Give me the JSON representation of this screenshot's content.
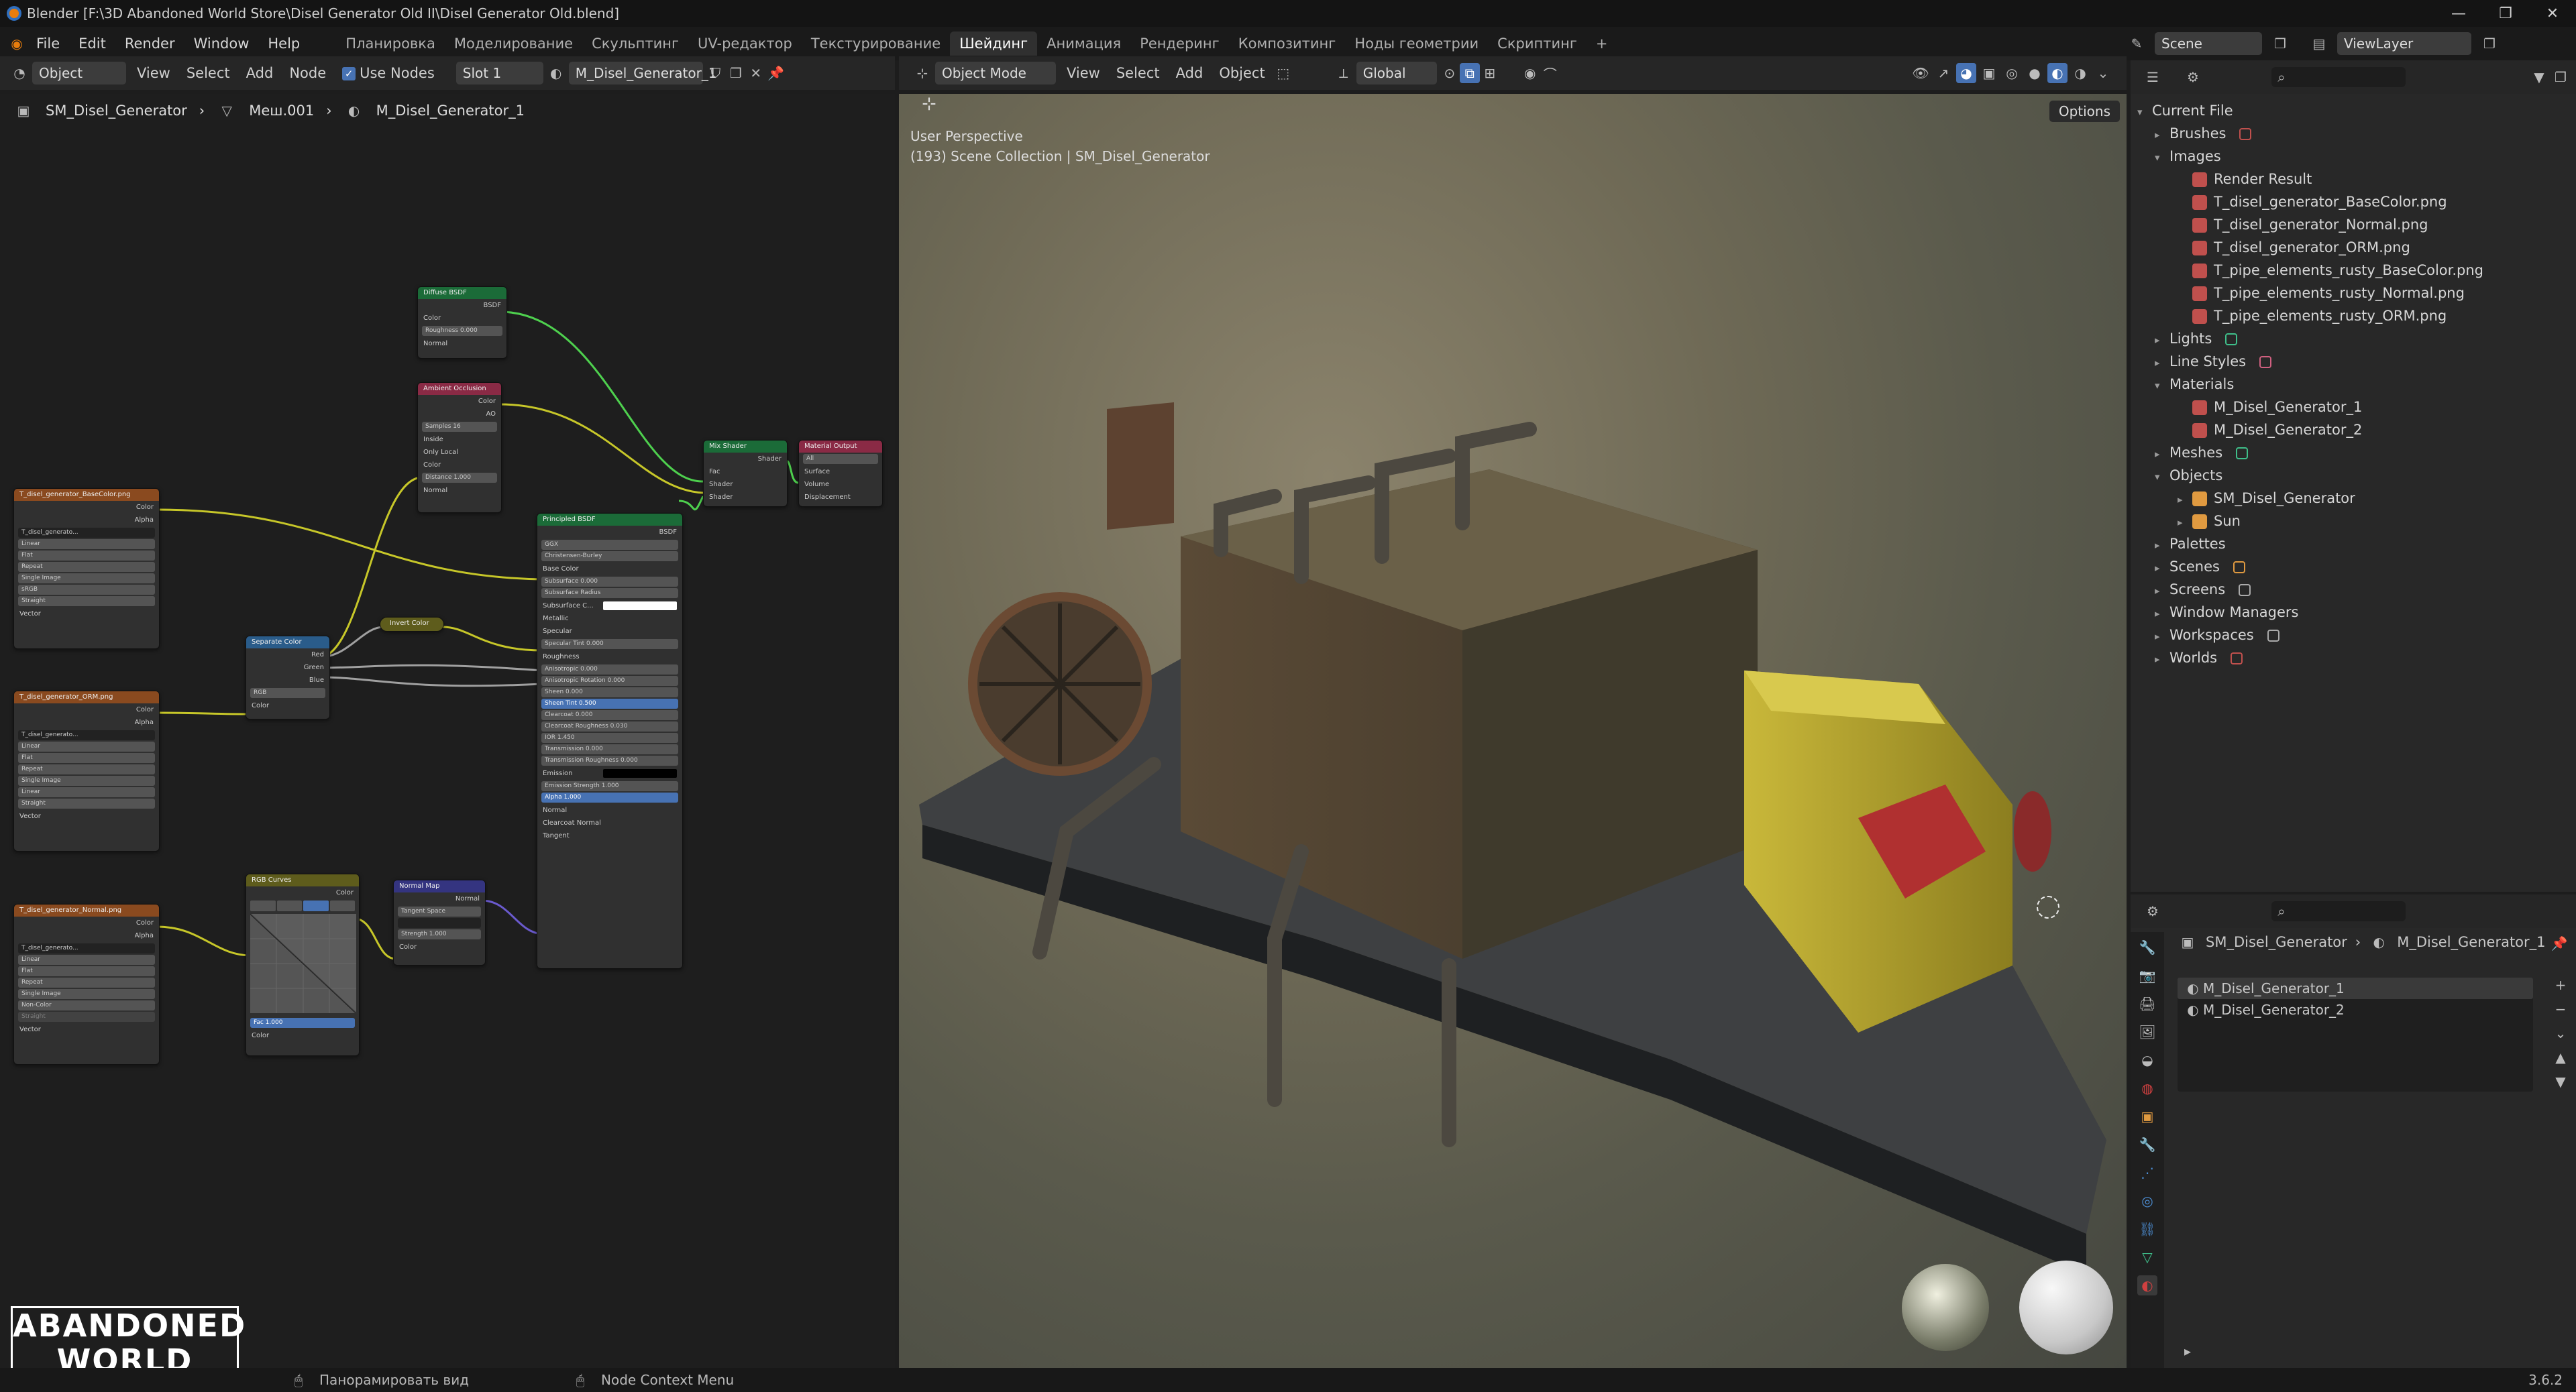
{
  "titlebar": {
    "title": "Blender [F:\\3D Abandoned World Store\\Disel Generator Old II\\Disel Generator Old.blend]",
    "controls": [
      "—",
      "❐",
      "✕"
    ]
  },
  "menu": {
    "items": [
      "File",
      "Edit",
      "Render",
      "Window",
      "Help"
    ],
    "workspaces": [
      "Планировка",
      "Моделирование",
      "Скульптинг",
      "UV-редактор",
      "Текстурирование",
      "Шейдинг",
      "Анимация",
      "Рендеринг",
      "Композитинг",
      "Ноды геометрии",
      "Скриптинг"
    ],
    "active_workspace": "Шейдинг",
    "add_tab": "+",
    "scene_label": "Scene",
    "viewlayer_label": "ViewLayer"
  },
  "node_header": {
    "mode": "Object",
    "menus": [
      "View",
      "Select",
      "Add",
      "Node"
    ],
    "use_nodes_label": "Use Nodes",
    "slot": "Slot 1",
    "material": "M_Disel_Generator_1"
  },
  "breadcrumb": {
    "object": "SM_Disel_Generator",
    "mesh": "Меш.001",
    "material": "M_Disel_Generator_1"
  },
  "nodes": {
    "diffuse": {
      "title": "Diffuse BSDF",
      "out": "BSDF",
      "rows": [
        "Color",
        "Roughness 0.000",
        "Normal"
      ]
    },
    "ao": {
      "title": "Ambient Occlusion",
      "outs": [
        "Color",
        "AO"
      ],
      "rows": [
        "Samples 16",
        "Inside",
        "Only Local",
        "Color",
        "Distance 1.000",
        "Normal"
      ]
    },
    "mix": {
      "title": "Mix Shader",
      "out": "Shader",
      "rows": [
        "Fac",
        "Shader",
        "Shader"
      ]
    },
    "output": {
      "title": "Material Output",
      "target": "All",
      "rows": [
        "Surface",
        "Volume",
        "Displacement"
      ]
    },
    "principled": {
      "title": "Principled BSDF",
      "out": "BSDF",
      "dist": "GGX",
      "sss": "Christensen-Burley",
      "rows": [
        "Base Color",
        "Subsurface 0.000",
        "Subsurface Radius",
        "Subsurface C...",
        "Metallic",
        "Specular",
        "Specular Tint 0.000",
        "Roughness",
        "Anisotropic 0.000",
        "Anisotropic Rotation 0.000",
        "Sheen 0.000",
        "Sheen Tint 0.500",
        "Clearcoat 0.000",
        "Clearcoat Roughness 0.030",
        "IOR 1.450",
        "Transmission 0.000",
        "Transmission Roughness 0.000",
        "Emission",
        "Emission Strength 1.000",
        "Alpha 1.000",
        "Normal",
        "Clearcoat Normal",
        "Tangent"
      ]
    },
    "tex_base": {
      "title": "T_disel_generator_BaseColor.png",
      "outs": [
        "Color",
        "Alpha"
      ],
      "img": "T_disel_generato...",
      "rows": [
        "Linear",
        "Flat",
        "Repeat",
        "Single Image"
      ],
      "colorspace": "sRGB",
      "alpha": "Straight",
      "vector": "Vector"
    },
    "tex_orm": {
      "title": "T_disel_generator_ORM.png",
      "outs": [
        "Color",
        "Alpha"
      ],
      "img": "T_disel_generato...",
      "rows": [
        "Linear",
        "Flat",
        "Repeat",
        "Single Image"
      ],
      "colorspace": "Linear",
      "alpha": "Straight",
      "vector": "Vector"
    },
    "tex_normal": {
      "title": "T_disel_generator_Normal.png",
      "outs": [
        "Color",
        "Alpha"
      ],
      "img": "T_disel_generato...",
      "rows": [
        "Linear",
        "Flat",
        "Repeat",
        "Single Image"
      ],
      "colorspace": "Non-Color",
      "alpha": "Straight",
      "vector": "Vector"
    },
    "separate": {
      "title": "Separate Color",
      "outs": [
        "Red",
        "Green",
        "Blue"
      ],
      "mode": "RGB",
      "in": "Color"
    },
    "invert": {
      "title": "Invert Color"
    },
    "curves": {
      "title": "RGB Curves",
      "out": "Color",
      "fac": "Fac 1.000",
      "in": "Color"
    },
    "normalmap": {
      "title": "Normal Map",
      "out": "Normal",
      "space": "Tangent Space",
      "strength": "Strength 1.000",
      "in": "Color"
    }
  },
  "viewport": {
    "mode": "Object Mode",
    "menus": [
      "View",
      "Select",
      "Add",
      "Object"
    ],
    "transform": "Global",
    "perspective": "User Perspective",
    "collection": "(193) Scene Collection | SM_Disel_Generator",
    "options": "Options"
  },
  "outliner": {
    "root": "Current File",
    "items": [
      {
        "label": "Brushes",
        "level": 1,
        "expanded": false,
        "color": "#c0504d"
      },
      {
        "label": "Images",
        "level": 1,
        "expanded": true,
        "color": ""
      },
      {
        "label": "Render Result",
        "level": 2,
        "color": "#c0504d"
      },
      {
        "label": "T_disel_generator_BaseColor.png",
        "level": 2,
        "color": "#c0504d"
      },
      {
        "label": "T_disel_generator_Normal.png",
        "level": 2,
        "color": "#c0504d"
      },
      {
        "label": "T_disel_generator_ORM.png",
        "level": 2,
        "color": "#c0504d"
      },
      {
        "label": "T_pipe_elements_rusty_BaseColor.png",
        "level": 2,
        "color": "#c0504d"
      },
      {
        "label": "T_pipe_elements_rusty_Normal.png",
        "level": 2,
        "color": "#c0504d"
      },
      {
        "label": "T_pipe_elements_rusty_ORM.png",
        "level": 2,
        "color": "#c0504d"
      },
      {
        "label": "Lights",
        "level": 1,
        "expanded": false,
        "color": "#3fbf8a"
      },
      {
        "label": "Line Styles",
        "level": 1,
        "expanded": false,
        "color": "#d06080"
      },
      {
        "label": "Materials",
        "level": 1,
        "expanded": true,
        "color": ""
      },
      {
        "label": "M_Disel_Generator_1",
        "level": 2,
        "color": "#c0504d"
      },
      {
        "label": "M_Disel_Generator_2",
        "level": 2,
        "color": "#c0504d"
      },
      {
        "label": "Meshes",
        "level": 1,
        "expanded": false,
        "color": "#3fbf8a"
      },
      {
        "label": "Objects",
        "level": 1,
        "expanded": true,
        "color": ""
      },
      {
        "label": "SM_Disel_Generator",
        "level": 2,
        "expanded": false,
        "color": "#e09a40"
      },
      {
        "label": "Sun",
        "level": 2,
        "expanded": false,
        "color": "#e09a40"
      },
      {
        "label": "Palettes",
        "level": 1,
        "expanded": false,
        "color": ""
      },
      {
        "label": "Scenes",
        "level": 1,
        "expanded": false,
        "color": "#e09a40"
      },
      {
        "label": "Screens",
        "level": 1,
        "expanded": false,
        "color": "#aaaaaa"
      },
      {
        "label": "Window Managers",
        "level": 1,
        "expanded": false,
        "color": ""
      },
      {
        "label": "Workspaces",
        "level": 1,
        "expanded": false,
        "color": "#aaaaaa"
      },
      {
        "label": "Worlds",
        "level": 1,
        "expanded": false,
        "color": "#c0504d"
      }
    ]
  },
  "properties": {
    "object": "SM_Disel_Generator",
    "material": "M_Disel_Generator_1",
    "slots": [
      "M_Disel_Generator_1",
      "M_Disel_Generator_2"
    ],
    "selected_slot": 0
  },
  "statusbar": {
    "hint1": "Панорамировать вид",
    "hint2": "Node Context Menu",
    "version": "3.6.2"
  },
  "watermark": {
    "line1": "ABANDONED",
    "line2": "WORLD"
  }
}
